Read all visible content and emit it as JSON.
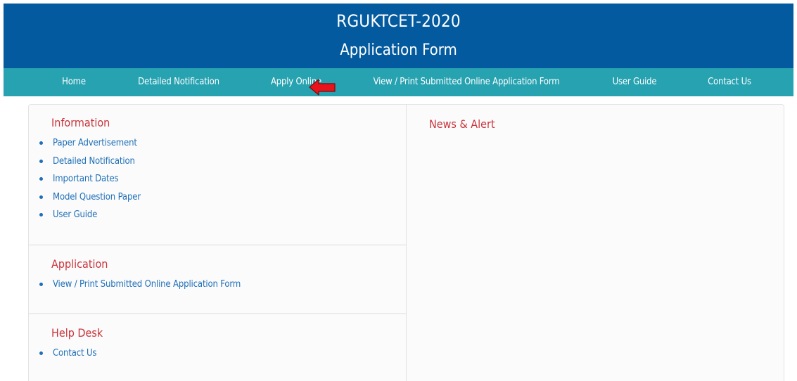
{
  "header": {
    "title": "RGUKTCET-2020",
    "subtitle": "Application Form"
  },
  "nav": {
    "items": [
      {
        "label": "Home"
      },
      {
        "label": "Detailed Notification"
      },
      {
        "label": "Apply Online"
      },
      {
        "label": "View / Print Submitted Online Application Form"
      },
      {
        "label": "User Guide"
      },
      {
        "label": "Contact Us"
      }
    ]
  },
  "pointer_arrow": {
    "icon": "red-left-arrow-icon",
    "color": "#e8131b"
  },
  "information": {
    "title": "Information",
    "links": [
      "Paper Advertisement",
      "Detailed Notification",
      "Important Dates",
      "Model Question Paper",
      "User Guide"
    ]
  },
  "application": {
    "title": "Application",
    "links": [
      "View / Print Submitted Online Application Form"
    ]
  },
  "help_desk": {
    "title": "Help Desk",
    "links": [
      "Contact Us"
    ]
  },
  "news": {
    "title": "News & Alert"
  },
  "colors": {
    "header_bg": "#035a9e",
    "nav_bg": "#27a2b0",
    "section_title": "#c9333b",
    "link": "#1f6fb8"
  }
}
